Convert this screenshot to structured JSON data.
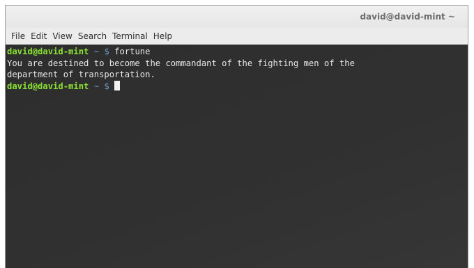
{
  "window": {
    "title": "david@david-mint ~"
  },
  "menubar": {
    "items": [
      "File",
      "Edit",
      "View",
      "Search",
      "Terminal",
      "Help"
    ]
  },
  "terminal": {
    "prompt_user": "david@david-mint",
    "prompt_path": "~",
    "prompt_symbol": "$",
    "command": "fortune",
    "output_lines": [
      "You are destined to become the commandant of the fighting men of the",
      "department of transportation."
    ]
  },
  "colors": {
    "terminal_background": "#2e2e2e",
    "prompt_user": "#8ae234",
    "prompt_path": "#729fcf",
    "text": "#e6e6e6"
  }
}
